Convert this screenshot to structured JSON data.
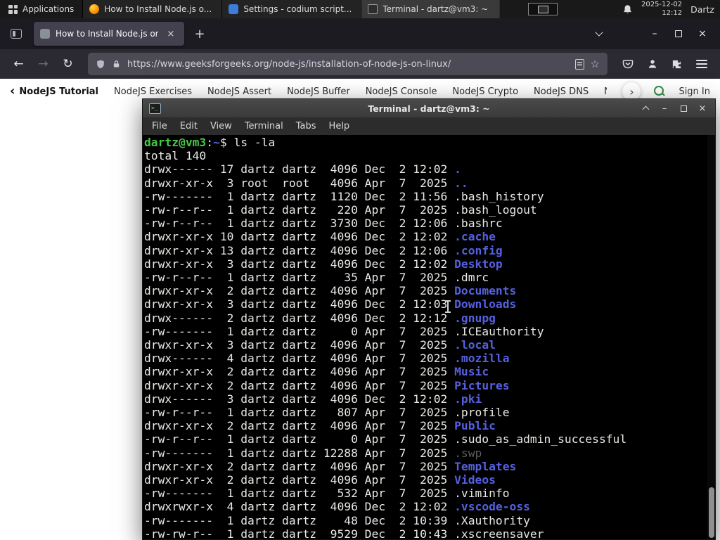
{
  "taskbar": {
    "applications_label": "Applications",
    "windows": [
      {
        "title": "How to Install Node.js o...",
        "icon": "firefox",
        "active": false
      },
      {
        "title": "Settings - codium script...",
        "icon": "settings",
        "active": false
      },
      {
        "title": "Terminal - dartz@vm3: ~",
        "icon": "terminal",
        "active": true
      }
    ],
    "clock": {
      "date": "2025-12-02",
      "time": "12:12"
    },
    "user_label": "Dartz"
  },
  "browser": {
    "tab_title": "How to Install Node.js on",
    "url": "https://www.geeksforgeeks.org/node-js/installation-of-node-js-on-linux/"
  },
  "site_nav": {
    "back_item": "NodeJS Tutorial",
    "items": [
      "NodeJS Exercises",
      "NodeJS Assert",
      "NodeJS Buffer",
      "NodeJS Console",
      "NodeJS Crypto",
      "NodeJS DNS",
      "Node"
    ],
    "sign_in_label": "Sign In"
  },
  "terminal": {
    "window_title": "Terminal - dartz@vm3: ~",
    "menu_items": [
      "File",
      "Edit",
      "View",
      "Terminal",
      "Tabs",
      "Help"
    ],
    "lines": [
      [
        {
          "t": "dartz@vm3",
          "c": "g"
        },
        {
          "t": ":",
          "c": "w"
        },
        {
          "t": "~",
          "c": "b"
        },
        {
          "t": "$ ls -la",
          "c": "w"
        }
      ],
      [
        {
          "t": "total 140",
          "c": "w"
        }
      ],
      [
        {
          "t": "drwx------ 17 dartz dartz  4096 Dec  2 12:02 ",
          "c": "w"
        },
        {
          "t": ".",
          "c": "b"
        }
      ],
      [
        {
          "t": "drwxr-xr-x  3 root  root   4096 Apr  7  2025 ",
          "c": "w"
        },
        {
          "t": "..",
          "c": "b"
        }
      ],
      [
        {
          "t": "-rw-------  1 dartz dartz  1120 Dec  2 11:56 .bash_history",
          "c": "w"
        }
      ],
      [
        {
          "t": "-rw-r--r--  1 dartz dartz   220 Apr  7  2025 .bash_logout",
          "c": "w"
        }
      ],
      [
        {
          "t": "-rw-r--r--  1 dartz dartz  3730 Dec  2 12:06 .bashrc",
          "c": "w"
        }
      ],
      [
        {
          "t": "drwxr-xr-x 10 dartz dartz  4096 Dec  2 12:02 ",
          "c": "w"
        },
        {
          "t": ".cache",
          "c": "b"
        }
      ],
      [
        {
          "t": "drwxr-xr-x 13 dartz dartz  4096 Dec  2 12:06 ",
          "c": "w"
        },
        {
          "t": ".config",
          "c": "b"
        }
      ],
      [
        {
          "t": "drwxr-xr-x  3 dartz dartz  4096 Dec  2 12:02 ",
          "c": "w"
        },
        {
          "t": "Desktop",
          "c": "b"
        }
      ],
      [
        {
          "t": "-rw-r--r--  1 dartz dartz    35 Apr  7  2025 .dmrc",
          "c": "w"
        }
      ],
      [
        {
          "t": "drwxr-xr-x  2 dartz dartz  4096 Apr  7  2025 ",
          "c": "w"
        },
        {
          "t": "Documents",
          "c": "b"
        }
      ],
      [
        {
          "t": "drwxr-xr-x  3 dartz dartz  4096 Dec  2 12:03 ",
          "c": "w"
        },
        {
          "t": "Downloads",
          "c": "b"
        }
      ],
      [
        {
          "t": "drwx------  2 dartz dartz  4096 Dec  2 12:12 ",
          "c": "w"
        },
        {
          "t": ".gnupg",
          "c": "b"
        }
      ],
      [
        {
          "t": "-rw-------  1 dartz dartz     0 Apr  7  2025 .ICEauthority",
          "c": "w"
        }
      ],
      [
        {
          "t": "drwxr-xr-x  3 dartz dartz  4096 Apr  7  2025 ",
          "c": "w"
        },
        {
          "t": ".local",
          "c": "b"
        }
      ],
      [
        {
          "t": "drwx------  4 dartz dartz  4096 Apr  7  2025 ",
          "c": "w"
        },
        {
          "t": ".mozilla",
          "c": "b"
        }
      ],
      [
        {
          "t": "drwxr-xr-x  2 dartz dartz  4096 Apr  7  2025 ",
          "c": "w"
        },
        {
          "t": "Music",
          "c": "b"
        }
      ],
      [
        {
          "t": "drwxr-xr-x  2 dartz dartz  4096 Apr  7  2025 ",
          "c": "w"
        },
        {
          "t": "Pictures",
          "c": "b"
        }
      ],
      [
        {
          "t": "drwx------  3 dartz dartz  4096 Dec  2 12:02 ",
          "c": "w"
        },
        {
          "t": ".pki",
          "c": "b"
        }
      ],
      [
        {
          "t": "-rw-r--r--  1 dartz dartz   807 Apr  7  2025 .profile",
          "c": "w"
        }
      ],
      [
        {
          "t": "drwxr-xr-x  2 dartz dartz  4096 Apr  7  2025 ",
          "c": "w"
        },
        {
          "t": "Public",
          "c": "b"
        }
      ],
      [
        {
          "t": "-rw-r--r--  1 dartz dartz     0 Apr  7  2025 .sudo_as_admin_successful",
          "c": "w"
        }
      ],
      [
        {
          "t": "-rw-------  1 dartz dartz 12288 Apr  7  2025 ",
          "c": "w"
        },
        {
          "t": ".swp",
          "c": "d"
        }
      ],
      [
        {
          "t": "drwxr-xr-x  2 dartz dartz  4096 Apr  7  2025 ",
          "c": "w"
        },
        {
          "t": "Templates",
          "c": "b"
        }
      ],
      [
        {
          "t": "drwxr-xr-x  2 dartz dartz  4096 Apr  7  2025 ",
          "c": "w"
        },
        {
          "t": "Videos",
          "c": "b"
        }
      ],
      [
        {
          "t": "-rw-------  1 dartz dartz   532 Apr  7  2025 .viminfo",
          "c": "w"
        }
      ],
      [
        {
          "t": "drwxrwxr-x  4 dartz dartz  4096 Dec  2 12:02 ",
          "c": "w"
        },
        {
          "t": ".vscode-oss",
          "c": "b"
        }
      ],
      [
        {
          "t": "-rw-------  1 dartz dartz    48 Dec  2 10:39 .Xauthority",
          "c": "w"
        }
      ],
      [
        {
          "t": "-rw-rw-r--  1 dartz dartz  9529 Dec  2 10:43 .xscreensaver",
          "c": "w"
        }
      ]
    ]
  },
  "icons": {
    "close": "×",
    "minimize": "–",
    "plus": "+",
    "back": "←",
    "forward": "→",
    "reload": "↻",
    "star": "☆",
    "chevron_left": "‹",
    "chevron_right": "›"
  },
  "colors": {
    "accent_green": "#2f8d46",
    "terminal_blue": "#5560e0",
    "terminal_green": "#46c946",
    "terminal_bg": "#000000"
  }
}
